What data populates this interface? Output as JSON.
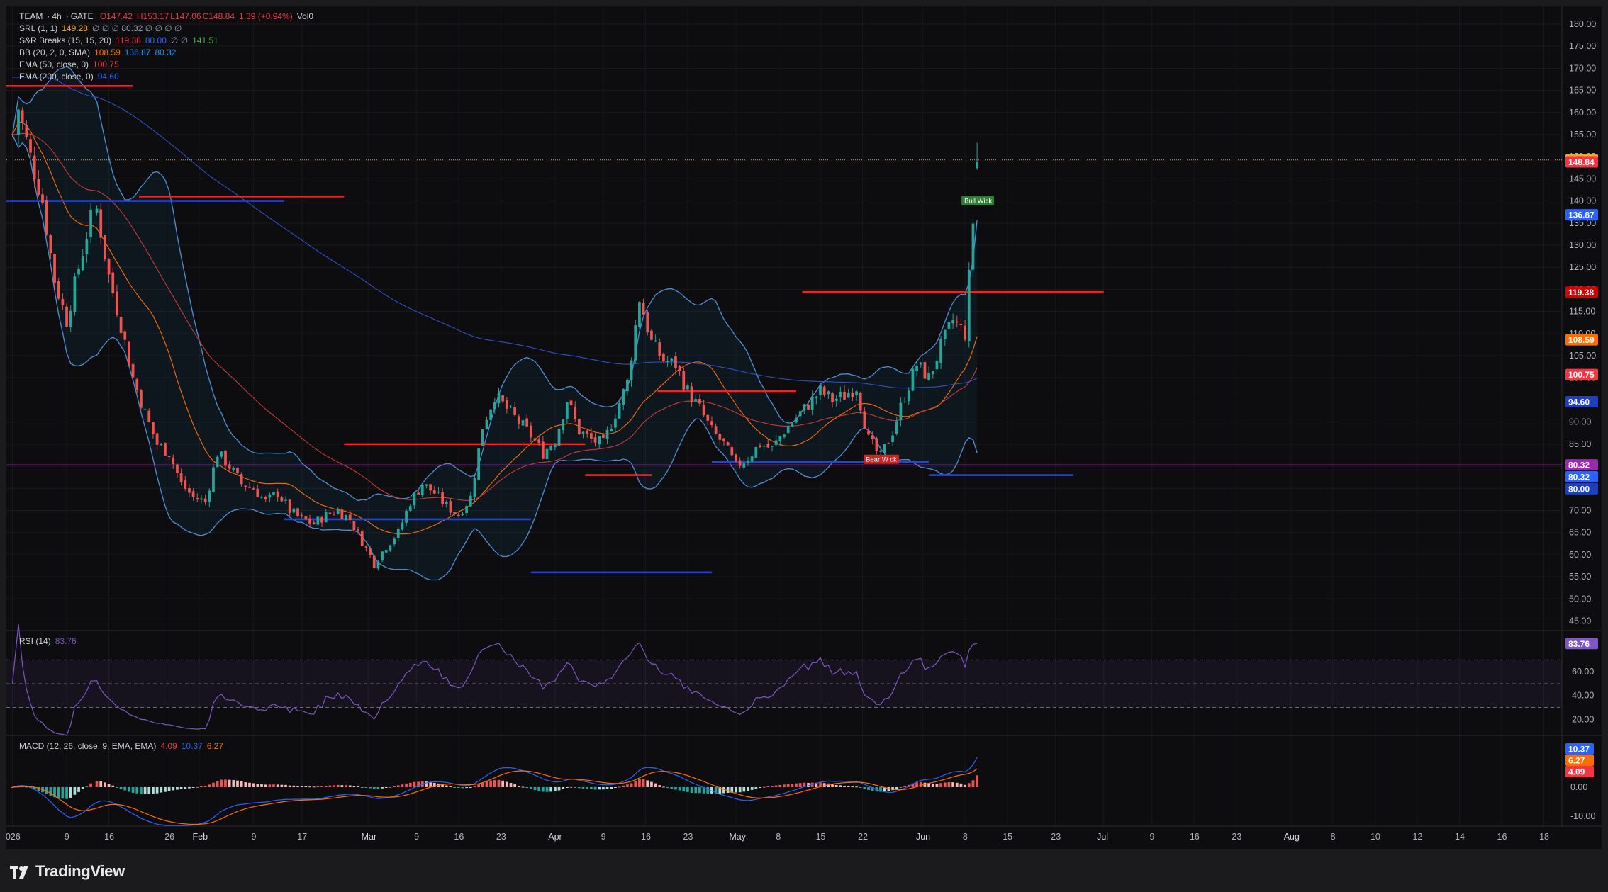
{
  "header": {
    "symbol": "TEAM",
    "interval": "4h",
    "exchange": "GATE",
    "open": "O147.42",
    "high": "H153.17",
    "low": "L147.06",
    "close": "C148.84",
    "change": "1.39 (+0.94%)",
    "volume": "Vol0"
  },
  "legend": {
    "srl": {
      "name": "SRL (1, 1)",
      "v1": "149.28",
      "rest": "∅ ∅ ∅ 80.32 ∅ ∅ ∅ ∅"
    },
    "sr_breaks": {
      "name": "S&R Breaks (15, 15, 20)",
      "v1": "119.38",
      "v2": "80.00",
      "rest": "∅ ∅",
      "v3": "141.51"
    },
    "bb": {
      "name": "BB (20, 2, 0, SMA)",
      "v1": "108.59",
      "v2": "136.87",
      "v3": "80.32"
    },
    "ema50": {
      "name": "EMA (50, close, 0)",
      "v1": "100.75"
    },
    "ema200": {
      "name": "EMA (200, close, 0)",
      "v1": "94.60"
    },
    "rsi": {
      "name": "RSI (14)",
      "v1": "83.76"
    },
    "macd": {
      "name": "MACD (12, 26, close, 9, EMA, EMA)",
      "v1": "4.09",
      "v2": "10.37",
      "v3": "6.27"
    }
  },
  "price_labels": [
    {
      "text": "149.28",
      "value": 149.28,
      "color": "#f5a623",
      "fg": "#000000"
    },
    {
      "text": "148.84",
      "value": 148.84,
      "color": "#f23645",
      "fg": "#ffffff"
    },
    {
      "text": "136.87",
      "value": 136.87,
      "color": "#2962ff",
      "fg": "#ffffff"
    },
    {
      "text": "119.38",
      "value": 119.38,
      "color": "#d50000",
      "fg": "#ffffff"
    },
    {
      "text": "108.59",
      "value": 108.59,
      "color": "#ff6d00",
      "fg": "#ffffff"
    },
    {
      "text": "100.75",
      "value": 100.75,
      "color": "#f23645",
      "fg": "#ffffff"
    },
    {
      "text": "94.60",
      "value": 94.6,
      "color": "#1e3fbf",
      "fg": "#ffffff"
    },
    {
      "text": "80.32",
      "value": 80.32,
      "color": "#9c27b0",
      "fg": "#ffffff"
    },
    {
      "text": "80.32",
      "value": 77.6,
      "color": "#2962ff",
      "fg": "#ffffff"
    },
    {
      "text": "80.00",
      "value": 74.9,
      "color": "#1e3fbf",
      "fg": "#ffffff"
    }
  ],
  "rsi_label": {
    "text": "83.76",
    "color": "#7e57c2"
  },
  "macd_labels": [
    {
      "text": "10.37",
      "value": 10.37,
      "color": "#2962ff"
    },
    {
      "text": "6.27",
      "value": 6.27,
      "color": "#ff6d00"
    },
    {
      "text": "4.09",
      "value": 4.09,
      "color": "#f23645"
    }
  ],
  "annotations": {
    "bull_wick": "Bull Wick",
    "bear_wick": "Bear W   ck"
  },
  "footer": {
    "brand": "TradingView"
  },
  "chart_data": [
    {
      "type": "candlestick",
      "title": "TEAM · 4h · GATE",
      "y_ticks": [
        45,
        50,
        55,
        60,
        65,
        70,
        75,
        80,
        85,
        90,
        95,
        100,
        105,
        110,
        115,
        120,
        125,
        130,
        135,
        140,
        145,
        150,
        155,
        160,
        165,
        170,
        175,
        180
      ],
      "ylim": [
        43,
        184
      ],
      "x_ticks": [
        "026",
        "9",
        "16",
        "26",
        "Feb",
        "9",
        "17",
        "Mar",
        "9",
        "16",
        "23",
        "Apr",
        "9",
        "16",
        "23",
        "May",
        "8",
        "15",
        "22",
        "Jun",
        "8",
        "15",
        "23",
        "Jul",
        "9",
        "16",
        "23",
        "Aug",
        "8",
        "10",
        "12",
        "14",
        "16",
        "18"
      ],
      "x_tick_days": [
        0,
        9,
        16,
        26,
        31,
        40,
        48,
        59,
        67,
        74,
        81,
        90,
        98,
        105,
        112,
        120,
        127,
        134,
        141,
        151,
        158,
        165,
        173,
        181,
        189,
        196,
        203,
        212,
        219,
        226,
        233,
        240,
        247,
        254
      ],
      "xlim_days": [
        -1,
        257
      ],
      "candles_close_keypoints": [
        [
          0,
          155
        ],
        [
          1,
          161
        ],
        [
          3,
          150
        ],
        [
          5,
          140
        ],
        [
          7,
          122
        ],
        [
          9,
          113
        ],
        [
          11,
          125
        ],
        [
          13,
          136
        ],
        [
          14,
          138
        ],
        [
          16,
          123
        ],
        [
          18,
          112
        ],
        [
          20,
          100
        ],
        [
          22,
          92
        ],
        [
          24,
          85
        ],
        [
          26,
          83
        ],
        [
          28,
          76
        ],
        [
          30,
          73
        ],
        [
          32,
          72
        ],
        [
          34,
          83
        ],
        [
          36,
          80
        ],
        [
          38,
          76
        ],
        [
          40,
          75
        ],
        [
          42,
          72
        ],
        [
          44,
          74
        ],
        [
          46,
          70
        ],
        [
          48,
          68
        ],
        [
          50,
          67
        ],
        [
          52,
          69
        ],
        [
          54,
          70
        ],
        [
          56,
          68
        ],
        [
          58,
          63
        ],
        [
          60,
          58
        ],
        [
          62,
          62
        ],
        [
          64,
          65
        ],
        [
          66,
          72
        ],
        [
          68,
          76
        ],
        [
          70,
          74
        ],
        [
          72,
          71
        ],
        [
          74,
          69
        ],
        [
          76,
          73
        ],
        [
          78,
          89
        ],
        [
          80,
          96
        ],
        [
          82,
          93
        ],
        [
          84,
          90
        ],
        [
          86,
          87
        ],
        [
          88,
          83
        ],
        [
          90,
          86
        ],
        [
          92,
          95
        ],
        [
          94,
          88
        ],
        [
          96,
          86
        ],
        [
          98,
          85
        ],
        [
          100,
          92
        ],
        [
          102,
          99
        ],
        [
          104,
          118
        ],
        [
          106,
          108
        ],
        [
          108,
          104
        ],
        [
          110,
          103
        ],
        [
          112,
          97
        ],
        [
          114,
          93
        ],
        [
          116,
          88
        ],
        [
          118,
          85
        ],
        [
          120,
          80
        ],
        [
          122,
          82
        ],
        [
          124,
          85
        ],
        [
          126,
          84
        ],
        [
          128,
          88
        ],
        [
          130,
          91
        ],
        [
          132,
          94
        ],
        [
          134,
          97
        ],
        [
          136,
          95
        ],
        [
          138,
          96
        ],
        [
          140,
          98
        ],
        [
          142,
          86
        ],
        [
          144,
          82
        ],
        [
          146,
          88
        ],
        [
          148,
          96
        ],
        [
          150,
          103
        ],
        [
          152,
          100
        ],
        [
          154,
          107
        ],
        [
          156,
          113
        ],
        [
          158,
          110
        ],
        [
          160,
          148
        ]
      ],
      "horizontal_levels": [
        {
          "color": "#ff1e1e",
          "value": 166,
          "x_from": -1,
          "x_to": 20
        },
        {
          "color": "#ff1e1e",
          "value": 141,
          "x_from": 21,
          "x_to": 55
        },
        {
          "color": "#2244dd",
          "value": 140,
          "x_from": -1,
          "x_to": 45
        },
        {
          "color": "#ff1e1e",
          "value": 85,
          "x_from": 55,
          "x_to": 95
        },
        {
          "color": "#2244dd",
          "value": 68,
          "x_from": 45,
          "x_to": 86
        },
        {
          "color": "#ff1e1e",
          "value": 78,
          "x_from": 95,
          "x_to": 106
        },
        {
          "color": "#2244dd",
          "value": 56,
          "x_from": 86,
          "x_to": 116
        },
        {
          "color": "#ff1e1e",
          "value": 97,
          "x_from": 107,
          "x_to": 130
        },
        {
          "color": "#2244dd",
          "value": 81,
          "x_from": 116,
          "x_to": 152
        },
        {
          "color": "#ff1e1e",
          "value": 119.38,
          "x_from": 131,
          "x_to": 181
        },
        {
          "color": "#2244dd",
          "value": 78,
          "x_from": 152,
          "x_to": 176
        }
      ],
      "hlines": [
        {
          "color": "#f5a623",
          "value": 149.28,
          "style": "dotted"
        },
        {
          "color": "#9c27b0",
          "value": 80.32,
          "style": "solid"
        }
      ]
    },
    {
      "type": "line",
      "title": "RSI (14)",
      "y_ticks": [
        20,
        40,
        60
      ],
      "bands": [
        30,
        50,
        70
      ],
      "last_value": 83.76
    },
    {
      "type": "bar",
      "title": "MACD (12, 26, close, 9, EMA, EMA)",
      "y_ticks": [
        -10,
        0
      ],
      "last": {
        "histogram": 4.09,
        "macd": 10.37,
        "signal": 6.27
      }
    }
  ]
}
